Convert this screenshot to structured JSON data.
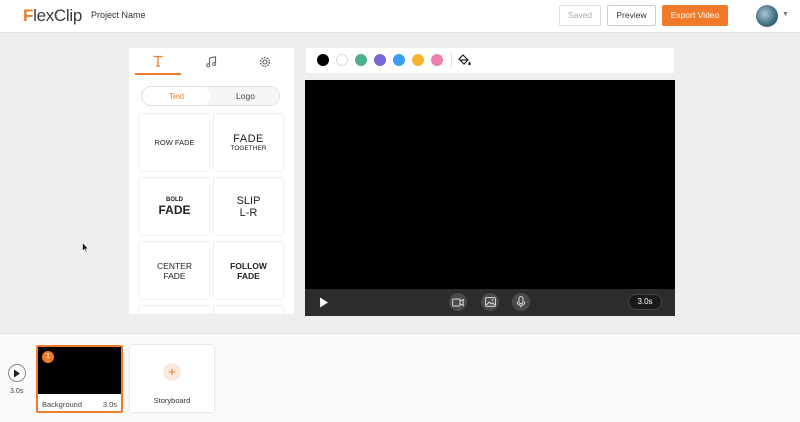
{
  "header": {
    "logo_f": "F",
    "logo_rest": "lexClip",
    "project_name": "Project Name",
    "saved_label": "Saved",
    "preview_label": "Preview",
    "export_label": "Export Video"
  },
  "panel": {
    "tabs": [
      "text-icon",
      "music-icon",
      "settings-icon"
    ],
    "toggle": {
      "active": "Text",
      "other": "Logo"
    },
    "cards": [
      {
        "l1": "ROW FADE",
        "l2": ""
      },
      {
        "l1": "FADE",
        "l2": "TOGETHER"
      },
      {
        "l1": "BOLD",
        "l2": "FADE"
      },
      {
        "l1": "SLIP",
        "l2": "L-R"
      },
      {
        "l1": "CENTER",
        "l2": "FADE"
      },
      {
        "l1": "FOLLOW",
        "l2": "FADE"
      }
    ]
  },
  "toolbar": {
    "colors": [
      "#000000",
      "#ffffff",
      "#4cb08e",
      "#7c67d6",
      "#3b9cf0",
      "#f3b52e",
      "#ef7fae"
    ]
  },
  "player": {
    "duration": "3.0s"
  },
  "timeline": {
    "total_duration": "3.0s",
    "clip": {
      "number": "1",
      "name": "Background",
      "duration": "3.0s"
    },
    "storyboard_label": "Storyboard",
    "storyboard_plus": "+"
  },
  "accent": "#f07a2a"
}
